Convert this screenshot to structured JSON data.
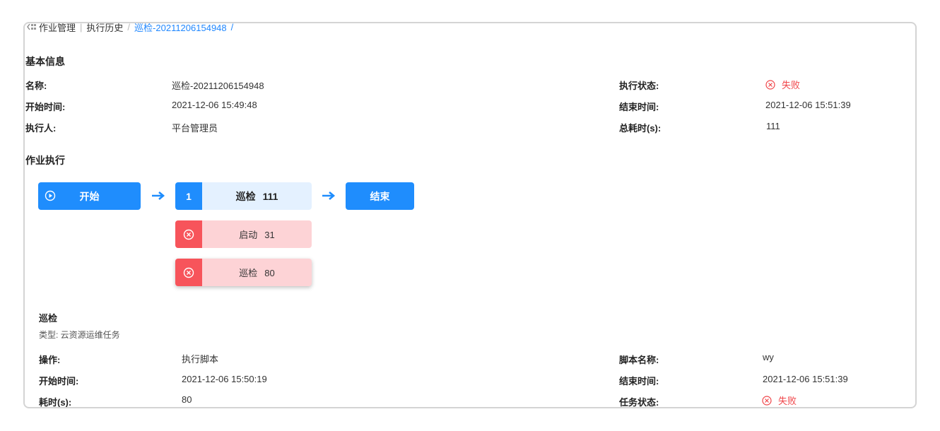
{
  "breadcrumb": {
    "icon": "back-grid-icon",
    "item1": "作业管理",
    "item2": "执行历史",
    "current": "巡检-20211206154948",
    "slash": "/"
  },
  "basic": {
    "title": "基本信息",
    "name_label": "名称:",
    "name_value": "巡检-20211206154948",
    "status_label": "执行状态:",
    "status_value": "失败",
    "start_label": "开始时间:",
    "start_value": "2021-12-06 15:49:48",
    "end_label": "结束时间:",
    "end_value": "2021-12-06 15:51:39",
    "executor_label": "执行人:",
    "executor_value": "平台管理员",
    "duration_label": "总耗时(s):",
    "duration_value": "111"
  },
  "execution": {
    "title": "作业执行",
    "start_node": "开始",
    "end_node": "结束",
    "task": {
      "index": "1",
      "name": "巡检",
      "time": "111"
    },
    "subtasks": [
      {
        "name": "启动",
        "time": "31",
        "status": "failed"
      },
      {
        "name": "巡检",
        "time": "80",
        "status": "failed"
      }
    ]
  },
  "detail": {
    "title": "巡检",
    "type_text": "类型: 云资源运维任务",
    "op_label": "操作:",
    "op_value": "执行脚本",
    "script_label": "脚本名称:",
    "script_value": "wy",
    "start_label": "开始时间:",
    "start_value": "2021-12-06 15:50:19",
    "end_label": "结束时间:",
    "end_value": "2021-12-06 15:51:39",
    "duration_label": "耗时(s):",
    "duration_value": "80",
    "status_label": "任务状态:",
    "status_value": "失败"
  },
  "colors": {
    "primary": "#1f8dfd",
    "fail_text": "#f0464a",
    "fail_bg": "#fdd3d6",
    "fail_icon_bg": "#f7545b",
    "task_bg": "#e4f1ff"
  }
}
